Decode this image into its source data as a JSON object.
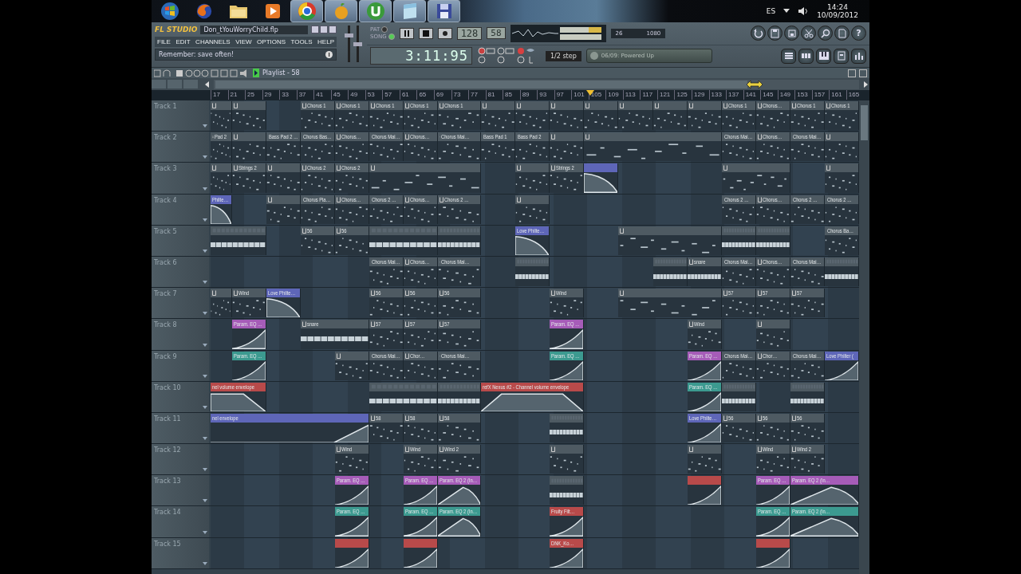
{
  "taskbar": {
    "apps": [
      {
        "kind": "orb",
        "running": false
      },
      {
        "kind": "fox",
        "running": false
      },
      {
        "kind": "folder",
        "running": false
      },
      {
        "kind": "media",
        "running": false
      },
      {
        "kind": "ring",
        "running": true
      },
      {
        "kind": "fruit",
        "running": true
      },
      {
        "kind": "torrent",
        "running": true
      },
      {
        "kind": "note",
        "running": true
      },
      {
        "kind": "disk",
        "running": true
      }
    ],
    "language": "ES",
    "time": "14:24",
    "date": "10/09/2012"
  },
  "fl": {
    "logo": "FL STUDIO",
    "file": "Don_tYouWorryChild.flp",
    "menu": [
      "FILE",
      "EDIT",
      "CHANNELS",
      "VIEW",
      "OPTIONS",
      "TOOLS",
      "HELP"
    ],
    "hint": "Remember: save often!",
    "volume": {
      "level": 0.75
    },
    "pitch": {
      "level": 0.5
    },
    "modes": [
      {
        "label": "PAT",
        "selected": false
      },
      {
        "label": "SONG",
        "selected": true
      }
    ],
    "tempo": "128",
    "pattern": "58",
    "time": "3:11:95",
    "cpu": "26",
    "memory": "1080",
    "snap": "1/2 step",
    "news": "06/09: Powered Up",
    "help": "?"
  },
  "playlist": {
    "title": "Playlist - 58",
    "ruler": [
      "17",
      "21",
      "25",
      "29",
      "33",
      "37",
      "41",
      "45",
      "49",
      "53",
      "57",
      "61",
      "65",
      "69",
      "73",
      "77",
      "81",
      "85",
      "89",
      "93",
      "97",
      "101",
      "105",
      "109",
      "113",
      "117",
      "121",
      "125",
      "129",
      "133",
      "137",
      "141",
      "145",
      "149",
      "153",
      "157",
      "161",
      "165"
    ],
    "tracks": [
      {
        "name": "Track 1",
        "cells": [
          {
            "kind": "pattern"
          },
          {
            "kind": "pattern"
          },
          {
            "kind": "empty"
          },
          {
            "kind": "pattern",
            "label": "Chorus 1"
          },
          {
            "kind": "pattern",
            "label": "Chorus 1"
          },
          {
            "kind": "pattern",
            "label": "Chorus 1"
          },
          {
            "kind": "pattern",
            "label": "Chorus 1"
          },
          {
            "kind": "pattern",
            "label": "Chorus 1"
          },
          {
            "kind": "pattern"
          },
          {
            "kind": "pattern"
          },
          {
            "kind": "pattern"
          },
          {
            "kind": "pattern"
          },
          {
            "kind": "pattern"
          },
          {
            "kind": "pattern"
          },
          {
            "kind": "pattern"
          },
          {
            "kind": "pattern",
            "label": "Chorus 1"
          },
          {
            "kind": "pattern",
            "label": "Chorus…"
          },
          {
            "kind": "pattern",
            "label": "Chorus 1"
          },
          {
            "kind": "pattern",
            "label": "Chorus 1"
          }
        ]
      },
      {
        "name": "Track 2",
        "cells": [
          {
            "kind": "pattern",
            "label": "Pad 2"
          },
          {
            "kind": "pattern"
          },
          {
            "kind": "pattern",
            "label": "Bass Pad 2 …"
          },
          {
            "kind": "pattern",
            "label": "Chorus Bas…"
          },
          {
            "kind": "pattern",
            "label": "Chorus…"
          },
          {
            "kind": "pattern",
            "label": "Chorus Mai…"
          },
          {
            "kind": "pattern",
            "label": "Chorus…"
          },
          {
            "kind": "pattern",
            "label": "Chorus Mai…"
          },
          {
            "kind": "pattern",
            "label": "Bass Pad 1"
          },
          {
            "kind": "pattern",
            "label": "Bass Pad 2"
          },
          {
            "kind": "pattern"
          },
          {
            "kind": "pattern"
          },
          {
            "kind": "more"
          },
          {
            "kind": "more"
          },
          {
            "kind": "more"
          },
          {
            "kind": "pattern",
            "label": "Chorus Mai…"
          },
          {
            "kind": "pattern",
            "label": "Chorus…"
          },
          {
            "kind": "pattern",
            "label": "Chorus Mai…"
          },
          {
            "kind": "pattern"
          }
        ]
      },
      {
        "name": "Track 3",
        "cells": [
          {
            "kind": "pattern"
          },
          {
            "kind": "pattern",
            "label": "Strings 2"
          },
          {
            "kind": "pattern"
          },
          {
            "kind": "pattern",
            "label": "Chorus 2"
          },
          {
            "kind": "pattern",
            "label": "Chorus 2"
          },
          {
            "kind": "pattern"
          },
          {
            "kind": "more"
          },
          {
            "kind": "more"
          },
          {
            "kind": "empty"
          },
          {
            "kind": "pattern"
          },
          {
            "kind": "pattern",
            "label": "Strings 2"
          },
          {
            "kind": "fall",
            "color": "#5e66b8"
          },
          {
            "kind": "empty"
          },
          {
            "kind": "empty"
          },
          {
            "kind": "empty"
          },
          {
            "kind": "pattern"
          },
          {
            "kind": "more"
          },
          {
            "kind": "empty"
          },
          {
            "kind": "pattern"
          }
        ]
      },
      {
        "name": "Track 4",
        "cells": [
          {
            "kind": "fall",
            "label": "Philte…",
            "color": "#5e66b8"
          },
          {
            "kind": "empty"
          },
          {
            "kind": "pattern"
          },
          {
            "kind": "pattern",
            "label": "Chorus Pia…"
          },
          {
            "kind": "pattern",
            "label": "Chorus…"
          },
          {
            "kind": "pattern",
            "label": "Chorus 2 …"
          },
          {
            "kind": "pattern",
            "label": "Chorus…"
          },
          {
            "kind": "pattern",
            "label": "Chorus 2 …"
          },
          {
            "kind": "empty"
          },
          {
            "kind": "pattern"
          },
          {
            "kind": "empty"
          },
          {
            "kind": "empty"
          },
          {
            "kind": "empty"
          },
          {
            "kind": "empty"
          },
          {
            "kind": "empty"
          },
          {
            "kind": "pattern",
            "label": "Chorus 2 …"
          },
          {
            "kind": "pattern",
            "label": "Chorus…"
          },
          {
            "kind": "pattern",
            "label": "Chorus 2 …"
          },
          {
            "kind": "pattern",
            "label": "Chorus 2 …"
          }
        ]
      },
      {
        "name": "Track 5",
        "cells": [
          {
            "kind": "steps"
          },
          {
            "kind": "more"
          },
          {
            "kind": "empty"
          },
          {
            "kind": "pattern",
            "label": "56"
          },
          {
            "kind": "pattern",
            "label": "56"
          },
          {
            "kind": "steps"
          },
          {
            "kind": "more"
          },
          {
            "kind": "steps"
          },
          {
            "kind": "empty"
          },
          {
            "kind": "fall",
            "label": "Love Philte…",
            "color": "#5e66b8"
          },
          {
            "kind": "empty"
          },
          {
            "kind": "empty"
          },
          {
            "kind": "pattern"
          },
          {
            "kind": "more"
          },
          {
            "kind": "more"
          },
          {
            "kind": "steps"
          },
          {
            "kind": "steps"
          },
          {
            "kind": "empty"
          },
          {
            "kind": "pattern",
            "label": "Chorus Ba…"
          }
        ]
      },
      {
        "name": "Track 6",
        "cells": [
          {
            "kind": "empty"
          },
          {
            "kind": "empty"
          },
          {
            "kind": "empty"
          },
          {
            "kind": "empty"
          },
          {
            "kind": "empty"
          },
          {
            "kind": "pattern",
            "label": "Chorus Mai…"
          },
          {
            "kind": "pattern",
            "label": "Chorus…"
          },
          {
            "kind": "pattern",
            "label": "Chorus Mai…"
          },
          {
            "kind": "empty"
          },
          {
            "kind": "steps"
          },
          {
            "kind": "empty"
          },
          {
            "kind": "empty"
          },
          {
            "kind": "empty"
          },
          {
            "kind": "steps"
          },
          {
            "kind": "steps",
            "label": "snare"
          },
          {
            "kind": "pattern",
            "label": "Chorus Mai…"
          },
          {
            "kind": "pattern",
            "label": "Chorus…"
          },
          {
            "kind": "pattern",
            "label": "Chorus Mai…"
          },
          {
            "kind": "steps"
          }
        ]
      },
      {
        "name": "Track 7",
        "cells": [
          {
            "kind": "pattern"
          },
          {
            "kind": "pattern",
            "label": "Wind"
          },
          {
            "kind": "fall",
            "label": "Love Philte…",
            "color": "#5e66b8"
          },
          {
            "kind": "empty"
          },
          {
            "kind": "empty"
          },
          {
            "kind": "pattern",
            "label": "56"
          },
          {
            "kind": "pattern",
            "label": "56"
          },
          {
            "kind": "pattern",
            "label": "56"
          },
          {
            "kind": "empty"
          },
          {
            "kind": "empty"
          },
          {
            "kind": "pattern",
            "label": "Wind"
          },
          {
            "kind": "empty"
          },
          {
            "kind": "pattern"
          },
          {
            "kind": "more"
          },
          {
            "kind": "more"
          },
          {
            "kind": "pattern",
            "label": "57"
          },
          {
            "kind": "pattern",
            "label": "57"
          },
          {
            "kind": "pattern",
            "label": "57"
          },
          {
            "kind": "empty"
          }
        ]
      },
      {
        "name": "Track 8",
        "cells": [
          {
            "kind": "empty"
          },
          {
            "kind": "rise",
            "label": "Param. EQ …",
            "color": "#a65cb8"
          },
          {
            "kind": "empty"
          },
          {
            "kind": "steps",
            "label": "snare"
          },
          {
            "kind": "more"
          },
          {
            "kind": "pattern",
            "label": "57"
          },
          {
            "kind": "pattern",
            "label": "57"
          },
          {
            "kind": "pattern",
            "label": "57"
          },
          {
            "kind": "empty"
          },
          {
            "kind": "empty"
          },
          {
            "kind": "rise",
            "label": "Param. EQ …",
            "color": "#a65cb8"
          },
          {
            "kind": "empty"
          },
          {
            "kind": "empty"
          },
          {
            "kind": "empty"
          },
          {
            "kind": "pattern",
            "label": "Wind"
          },
          {
            "kind": "empty"
          },
          {
            "kind": "pattern"
          },
          {
            "kind": "empty"
          },
          {
            "kind": "empty"
          }
        ]
      },
      {
        "name": "Track 9",
        "cells": [
          {
            "kind": "empty"
          },
          {
            "kind": "rise",
            "label": "Param. EQ …",
            "color": "#3c9a90"
          },
          {
            "kind": "empty"
          },
          {
            "kind": "empty"
          },
          {
            "kind": "pattern"
          },
          {
            "kind": "pattern",
            "label": "Chorus Mai…"
          },
          {
            "kind": "pattern",
            "label": "Chor…"
          },
          {
            "kind": "pattern",
            "label": "Chorus Mai…"
          },
          {
            "kind": "empty"
          },
          {
            "kind": "empty"
          },
          {
            "kind": "rise",
            "label": "Param. EQ …",
            "color": "#3c9a90"
          },
          {
            "kind": "empty"
          },
          {
            "kind": "empty"
          },
          {
            "kind": "empty"
          },
          {
            "kind": "rise",
            "label": "Param. EQ …",
            "color": "#a65cb8"
          },
          {
            "kind": "pattern",
            "label": "Chorus Mai…"
          },
          {
            "kind": "pattern",
            "label": "Chor…"
          },
          {
            "kind": "pattern",
            "label": "Chorus Mai…"
          },
          {
            "kind": "rise",
            "label": "Love Philter (",
            "color": "#5e66b8"
          }
        ]
      },
      {
        "name": "Track 10",
        "cells": [
          {
            "kind": "plateau_fall",
            "label": "nel volume envelope",
            "color": "#b84a4a"
          },
          {
            "kind": "more"
          },
          {
            "kind": "empty"
          },
          {
            "kind": "empty"
          },
          {
            "kind": "empty"
          },
          {
            "kind": "steps"
          },
          {
            "kind": "more"
          },
          {
            "kind": "steps"
          },
          {
            "kind": "trapezoid",
            "label": "refX Nexus #2 - Channel volume envelope",
            "color": "#b84a4a"
          },
          {
            "kind": "more"
          },
          {
            "kind": "more"
          },
          {
            "kind": "empty"
          },
          {
            "kind": "empty"
          },
          {
            "kind": "empty"
          },
          {
            "kind": "rise",
            "label": "Param. EQ …",
            "color": "#3c9a90"
          },
          {
            "kind": "steps"
          },
          {
            "kind": "empty"
          },
          {
            "kind": "steps"
          },
          {
            "kind": "empty"
          }
        ]
      },
      {
        "name": "Track 11",
        "cells": [
          {
            "kind": "late_rise",
            "label": "nel envelope",
            "color": "#5e66b8"
          },
          {
            "kind": "more"
          },
          {
            "kind": "more"
          },
          {
            "kind": "more"
          },
          {
            "kind": "more"
          },
          {
            "kind": "pattern",
            "label": "58"
          },
          {
            "kind": "pattern",
            "label": "58"
          },
          {
            "kind": "pattern",
            "label": "58"
          },
          {
            "kind": "empty"
          },
          {
            "kind": "empty"
          },
          {
            "kind": "steps"
          },
          {
            "kind": "empty"
          },
          {
            "kind": "empty"
          },
          {
            "kind": "empty"
          },
          {
            "kind": "rise",
            "label": "Love Philte…",
            "color": "#5e66b8"
          },
          {
            "kind": "pattern",
            "label": "56"
          },
          {
            "kind": "pattern",
            "label": "56"
          },
          {
            "kind": "pattern",
            "label": "56"
          },
          {
            "kind": "empty"
          }
        ]
      },
      {
        "name": "Track 12",
        "cells": [
          {
            "kind": "empty"
          },
          {
            "kind": "empty"
          },
          {
            "kind": "empty"
          },
          {
            "kind": "empty"
          },
          {
            "kind": "pattern",
            "label": "Wind"
          },
          {
            "kind": "empty"
          },
          {
            "kind": "pattern",
            "label": "Wind"
          },
          {
            "kind": "pattern",
            "label": "Wind 2"
          },
          {
            "kind": "empty"
          },
          {
            "kind": "empty"
          },
          {
            "kind": "pattern"
          },
          {
            "kind": "empty"
          },
          {
            "kind": "empty"
          },
          {
            "kind": "empty"
          },
          {
            "kind": "pattern"
          },
          {
            "kind": "empty"
          },
          {
            "kind": "pattern",
            "label": "Wind"
          },
          {
            "kind": "pattern",
            "label": "Wind 2"
          },
          {
            "kind": "empty"
          }
        ]
      },
      {
        "name": "Track 13",
        "cells": [
          {
            "kind": "empty"
          },
          {
            "kind": "empty"
          },
          {
            "kind": "empty"
          },
          {
            "kind": "empty"
          },
          {
            "kind": "rise",
            "label": "Param. EQ …",
            "color": "#a65cb8"
          },
          {
            "kind": "empty"
          },
          {
            "kind": "rise",
            "label": "Param. EQ …",
            "color": "#a65cb8"
          },
          {
            "kind": "hump",
            "label": "Param. EQ 2 (In…",
            "color": "#a65cb8"
          },
          {
            "kind": "empty"
          },
          {
            "kind": "empty"
          },
          {
            "kind": "steps"
          },
          {
            "kind": "empty"
          },
          {
            "kind": "empty"
          },
          {
            "kind": "empty"
          },
          {
            "kind": "rise",
            "color": "#b84a4a"
          },
          {
            "kind": "empty"
          },
          {
            "kind": "rise",
            "label": "Param. EQ …",
            "color": "#a65cb8"
          },
          {
            "kind": "hump",
            "label": "Param. EQ 2 (In…",
            "color": "#a65cb8"
          },
          {
            "kind": "more"
          }
        ]
      },
      {
        "name": "Track 14",
        "cells": [
          {
            "kind": "empty"
          },
          {
            "kind": "empty"
          },
          {
            "kind": "empty"
          },
          {
            "kind": "empty"
          },
          {
            "kind": "rise",
            "label": "Param. EQ …",
            "color": "#3c9a90"
          },
          {
            "kind": "empty"
          },
          {
            "kind": "rise",
            "label": "Param. EQ …",
            "color": "#3c9a90"
          },
          {
            "kind": "hump",
            "label": "Param. EQ 2 (In…",
            "color": "#3c9a90"
          },
          {
            "kind": "empty"
          },
          {
            "kind": "empty"
          },
          {
            "kind": "rise",
            "label": "Fruity Filt…",
            "color": "#b84a4a"
          },
          {
            "kind": "empty"
          },
          {
            "kind": "empty"
          },
          {
            "kind": "empty"
          },
          {
            "kind": "empty"
          },
          {
            "kind": "empty"
          },
          {
            "kind": "rise",
            "label": "Param. EQ …",
            "color": "#3c9a90"
          },
          {
            "kind": "hump",
            "label": "Param. EQ 2 (In…",
            "color": "#3c9a90"
          },
          {
            "kind": "more"
          }
        ]
      },
      {
        "name": "Track 15",
        "cells": [
          {
            "kind": "empty"
          },
          {
            "kind": "empty"
          },
          {
            "kind": "empty"
          },
          {
            "kind": "empty"
          },
          {
            "kind": "rise",
            "color": "#b84a4a"
          },
          {
            "kind": "empty"
          },
          {
            "kind": "rise",
            "color": "#b84a4a"
          },
          {
            "kind": "empty"
          },
          {
            "kind": "empty"
          },
          {
            "kind": "empty"
          },
          {
            "kind": "rise",
            "label": "DNK_Ko…",
            "color": "#b84a4a"
          },
          {
            "kind": "empty"
          },
          {
            "kind": "empty"
          },
          {
            "kind": "empty"
          },
          {
            "kind": "empty"
          },
          {
            "kind": "empty"
          },
          {
            "kind": "rise",
            "color": "#b84a4a"
          },
          {
            "kind": "empty"
          },
          {
            "kind": "empty"
          }
        ]
      }
    ]
  }
}
